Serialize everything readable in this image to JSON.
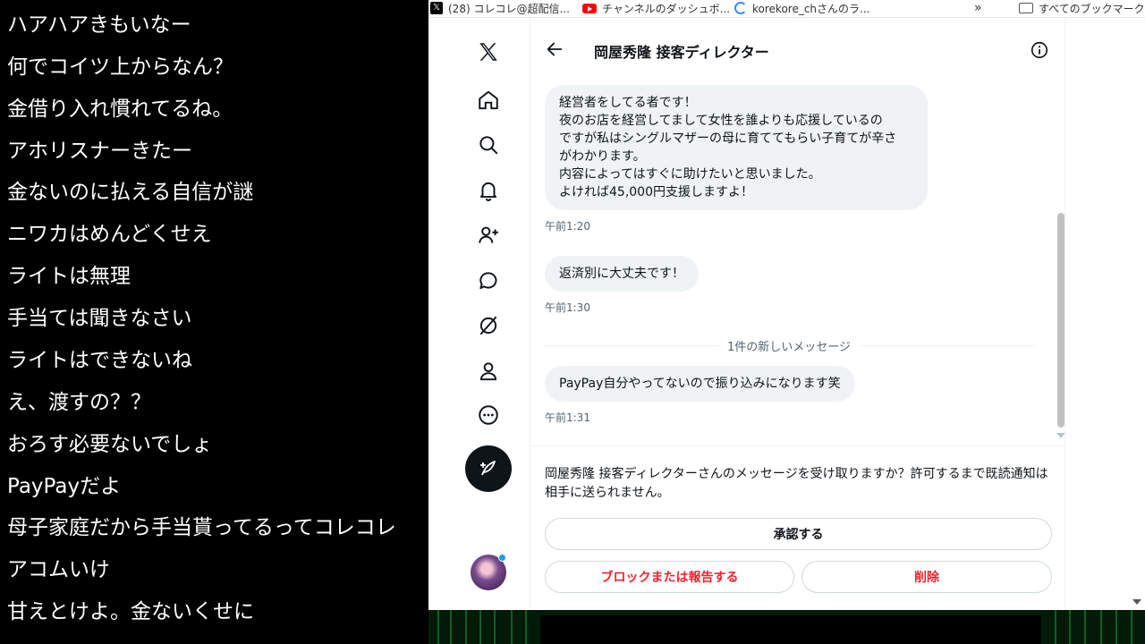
{
  "comments": [
    "ハアハアきもいなー",
    "何でコイツ上からなん？",
    "金借り入れ慣れてるね。",
    "アホリスナーきたー",
    "金ないのに払える自信が謎",
    "ニワカはめんどくせえ",
    "ライトは無理",
    "手当ては聞きなさい",
    "ライトはできないね",
    "え、渡すの？？",
    "おろす必要ないでしょ",
    "PayPayだよ",
    "母子家庭だから手当貰ってるってコレコレ",
    "アコムいけ",
    "甘えとけよ。金ないくせに"
  ],
  "bookmarks": {
    "items": [
      {
        "icon": "x-logo-icon",
        "label": "(28) コレコレ@超配信..."
      },
      {
        "icon": "youtube-icon",
        "label": "チャンネルのダッシュボ..."
      },
      {
        "icon": "loading-ring-icon",
        "label": "korekore_chさんのラ..."
      }
    ],
    "more": "»",
    "folder_label": "すべてのブックマーク"
  },
  "nav": {
    "icons": [
      "x-logo-icon",
      "home-icon",
      "search-icon",
      "notifications-icon",
      "follow-icon",
      "messages-icon",
      "grok-icon",
      "profile-icon",
      "more-icon"
    ],
    "post_icon": "compose-icon"
  },
  "conversation": {
    "title": "岡屋秀隆 接客ディレクター",
    "messages": [
      {
        "text": "経営者をしてる者です！\n夜のお店を経営してまして女性を誰よりも応援しているの\nですが私はシングルマザーの母に育ててもらい子育てが辛さ\nがわかります。\n内容によってはすぐに助けたいと思いました。\nよければ45,000円支援しますよ！",
        "time": "午前1:20"
      },
      {
        "text": "返済別に大丈夫です！",
        "time": "午前1:30"
      },
      {
        "text": "PayPay自分やってないので振り込みになります笑",
        "time": "午前1:31"
      }
    ],
    "new_messages_divider": "1件の新しいメッセージ",
    "request_text": "岡屋秀隆 接客ディレクターさんのメッセージを受け取りますか？許可するまで既読通知は相手に送られません。",
    "accept_label": "承認する",
    "block_label": "ブロックまたは報告する",
    "delete_label": "削除"
  },
  "colors": {
    "accent_red": "#f4212e",
    "text": "#0f1419",
    "muted": "#536471",
    "bubble": "#eff3f4"
  }
}
